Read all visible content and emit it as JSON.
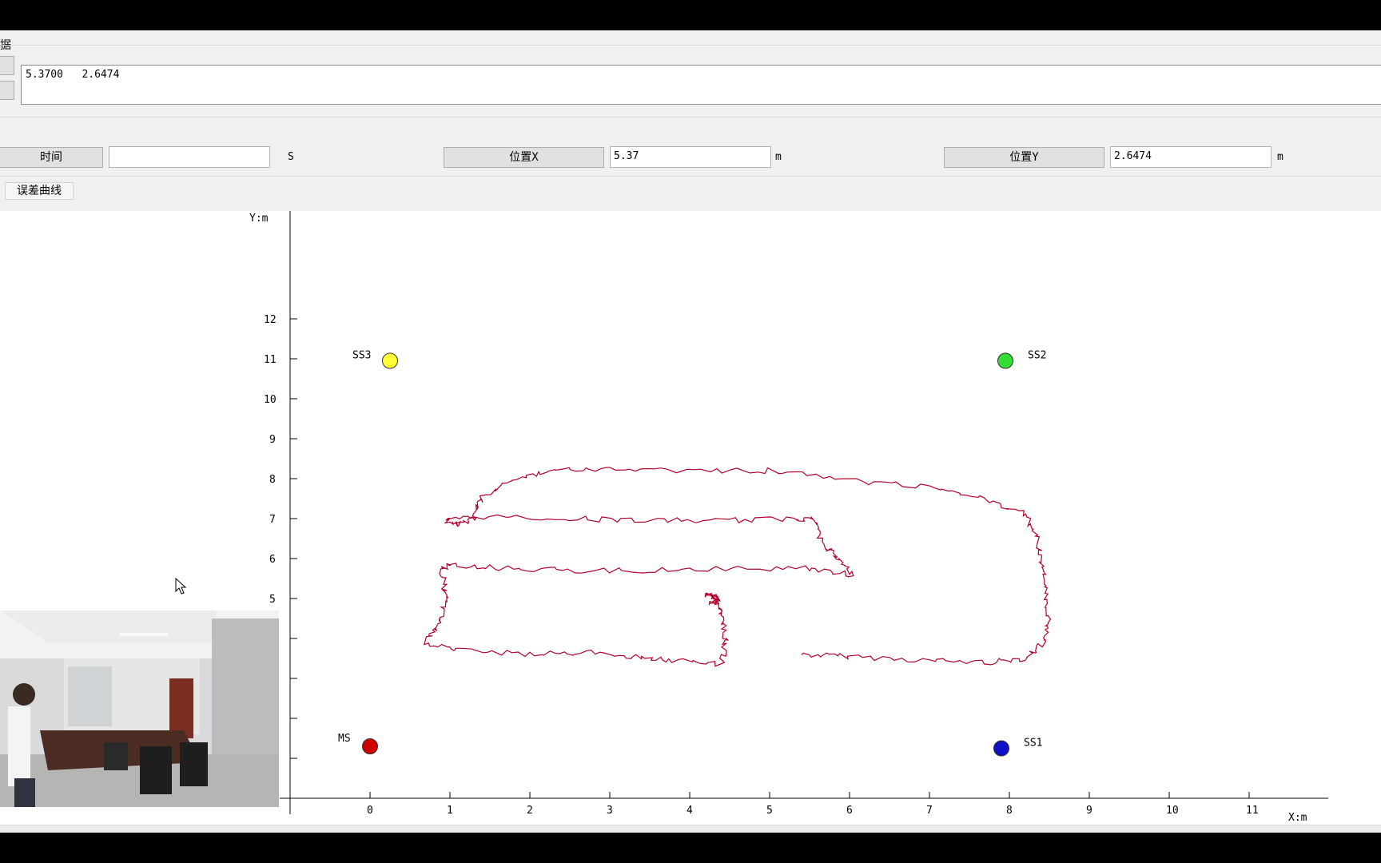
{
  "group": {
    "title": "据"
  },
  "result": {
    "text": "5.3700   2.6474"
  },
  "controls": {
    "time_label": "时间",
    "time_value": "",
    "time_unit": "S",
    "x_label": "位置X",
    "x_value": "5.37",
    "x_unit": "m",
    "y_label": "位置Y",
    "y_value": "2.6474",
    "y_unit": "m"
  },
  "tabs": {
    "error_curve": "误差曲线"
  },
  "chart_data": {
    "type": "scatter",
    "xlabel": "X:m",
    "ylabel": "Y:m",
    "xlim": [
      -0.7,
      12.2
    ],
    "ylim": [
      0,
      13
    ],
    "x_ticks": [
      0,
      1,
      2,
      3,
      4,
      5,
      6,
      7,
      8,
      9,
      10,
      11
    ],
    "y_ticks": [
      3,
      4,
      5,
      6,
      7,
      8,
      9,
      10,
      11,
      12
    ],
    "stations": [
      {
        "name": "SS3",
        "x": 0.25,
        "y": 10.95,
        "color": "#ffff33"
      },
      {
        "name": "SS2",
        "x": 7.95,
        "y": 10.95,
        "color": "#33dd33"
      },
      {
        "name": "SS1",
        "x": 7.9,
        "y": 1.25,
        "color": "#1010c8"
      },
      {
        "name": "MS",
        "x": 0.0,
        "y": 1.3,
        "color": "#cc0000"
      }
    ],
    "track_color": "#b0002a",
    "track": [
      [
        5.4,
        3.6
      ],
      [
        6.0,
        3.55
      ],
      [
        7.0,
        3.45
      ],
      [
        7.7,
        3.4
      ],
      [
        8.2,
        3.5
      ],
      [
        8.45,
        3.9
      ],
      [
        8.5,
        4.5
      ],
      [
        8.45,
        5.2
      ],
      [
        8.4,
        5.9
      ],
      [
        8.35,
        6.5
      ],
      [
        8.2,
        7.1
      ],
      [
        7.7,
        7.5
      ],
      [
        7.0,
        7.8
      ],
      [
        6.0,
        7.95
      ],
      [
        5.0,
        8.2
      ],
      [
        4.0,
        8.2
      ],
      [
        3.0,
        8.25
      ],
      [
        2.3,
        8.2
      ],
      [
        1.8,
        8.0
      ],
      [
        1.4,
        7.5
      ],
      [
        1.3,
        7.0
      ],
      [
        1.1,
        6.85
      ],
      [
        0.95,
        6.95
      ],
      [
        1.4,
        7.05
      ],
      [
        2.5,
        7.0
      ],
      [
        3.5,
        6.95
      ],
      [
        4.5,
        6.95
      ],
      [
        5.3,
        7.0
      ],
      [
        5.55,
        7.0
      ],
      [
        5.65,
        6.4
      ],
      [
        5.85,
        6.0
      ],
      [
        6.05,
        5.6
      ],
      [
        5.5,
        5.75
      ],
      [
        4.5,
        5.75
      ],
      [
        3.5,
        5.7
      ],
      [
        2.5,
        5.7
      ],
      [
        1.7,
        5.75
      ],
      [
        1.0,
        5.85
      ],
      [
        0.9,
        5.7
      ],
      [
        0.95,
        5.0
      ],
      [
        0.85,
        4.3
      ],
      [
        0.7,
        3.9
      ],
      [
        1.1,
        3.7
      ],
      [
        2.0,
        3.6
      ],
      [
        2.7,
        3.65
      ],
      [
        3.3,
        3.55
      ],
      [
        3.8,
        3.45
      ],
      [
        4.4,
        3.35
      ],
      [
        4.45,
        4.0
      ],
      [
        4.4,
        4.6
      ],
      [
        4.35,
        5.0
      ],
      [
        4.2,
        5.1
      ],
      [
        4.3,
        5.05
      ],
      [
        4.35,
        4.95
      ],
      [
        4.25,
        4.9
      ],
      [
        4.35,
        4.85
      ]
    ]
  },
  "photo": {
    "label": ""
  }
}
